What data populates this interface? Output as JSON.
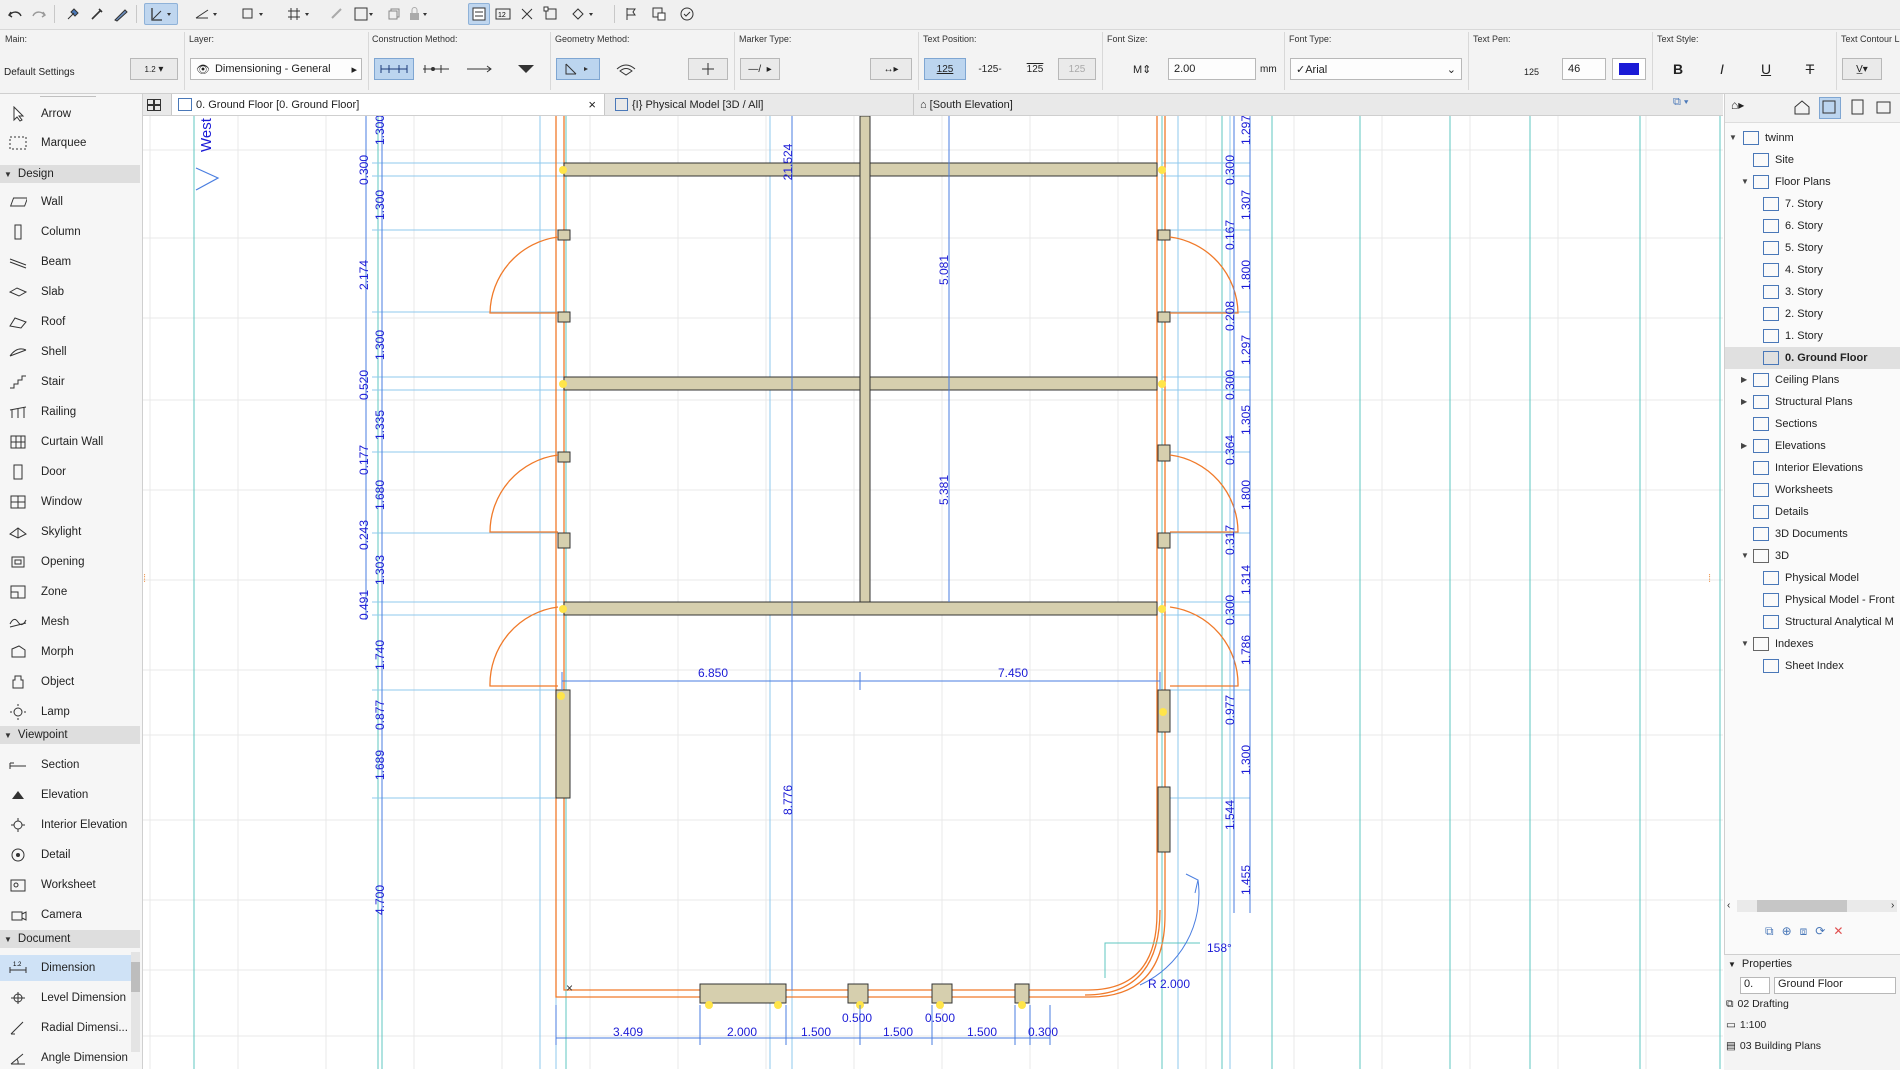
{
  "toolbar": {
    "icons": [
      "undo-icon",
      "redo-icon",
      "pick-up-icon",
      "eyedropper-icon",
      "inject-icon",
      "select-arrow-icon",
      "snap-guide-icon",
      "gravity-icon",
      "grid-icon",
      "lock-icon",
      "trace-icon",
      "layout-icon",
      "3d-view-icon",
      "flag-icon",
      "renovation-icon"
    ]
  },
  "infobox": {
    "main_label": "Main:",
    "main_value": "Default Settings",
    "main_scale": "1.2",
    "layer_label": "Layer:",
    "layer_value": "Dimensioning - General",
    "construction_label": "Construction Method:",
    "geometry_label": "Geometry Method:",
    "marker_label": "Marker Type:",
    "text_position_label": "Text Position:",
    "text_position_options": [
      "125",
      "-125-",
      "125",
      "125"
    ],
    "font_size_label": "Font Size:",
    "font_size_value": "2.00",
    "font_size_unit": "mm",
    "font_type_label": "Font Type:",
    "font_type_value": "✓Arial",
    "text_pen_label": "Text Pen:",
    "text_pen_prefix": "125",
    "text_pen_value": "46",
    "text_style_label": "Text Style:",
    "text_style_buttons": [
      "B",
      "I",
      "U",
      "T"
    ],
    "text_contour_label": "Text Contour Li"
  },
  "toolbox": {
    "arrow": "Arrow",
    "marquee": "Marquee",
    "design_group": "Design",
    "design_tools": [
      "Wall",
      "Column",
      "Beam",
      "Slab",
      "Roof",
      "Shell",
      "Stair",
      "Railing",
      "Curtain Wall",
      "Door",
      "Window",
      "Skylight",
      "Opening",
      "Zone",
      "Mesh",
      "Morph",
      "Object",
      "Lamp"
    ],
    "viewpoint_group": "Viewpoint",
    "viewpoint_tools": [
      "Section",
      "Elevation",
      "Interior Elevation",
      "Detail",
      "Worksheet",
      "Camera"
    ],
    "document_group": "Document",
    "document_tools": [
      "Dimension",
      "Level Dimension",
      "Radial Dimensi...",
      "Angle Dimension"
    ],
    "selected_tool": "Dimension"
  },
  "tabs": [
    {
      "label": "0. Ground Floor [0. Ground Floor]",
      "active": true,
      "close": "×"
    },
    {
      "label": "{I} Physical Model [3D / All]",
      "active": false
    },
    {
      "label": "[South Elevation]",
      "active": false
    }
  ],
  "canvas": {
    "elevation_marker": "West",
    "top_dim_text": "21.524",
    "left_dims": [
      "1.300",
      "0.300",
      "1.300",
      "2.174",
      "1.300",
      "0.520",
      "1.335",
      "0.177",
      "1.680",
      "0.243",
      "1.303",
      "0.491",
      "1.740",
      "0.877",
      "1.689",
      "4.700"
    ],
    "right_dims": [
      "1.297",
      "0.300",
      "1.307",
      "0.167",
      "1.800",
      "0.208",
      "1.297",
      "0.300",
      "1.305",
      "0.364",
      "1.800",
      "0.317",
      "1.314",
      "0.300",
      "1.786",
      "0.977",
      "1.300",
      "1.544",
      "1.455"
    ],
    "inner_vertical_dims": [
      "5.081",
      "5.381",
      "8.776"
    ],
    "horizontal_dims": [
      "6.850",
      "7.450"
    ],
    "bottom_dims": [
      "3.409",
      "2.000",
      "1.500",
      "0.500",
      "1.500",
      "0.500",
      "1.500",
      "0.300"
    ],
    "angle_text": "158°",
    "radius_text": "R 2.000"
  },
  "navigator": {
    "project": "twinm",
    "site": "Site",
    "floor_plans": "Floor Plans",
    "stories": [
      "7. Story",
      "6. Story",
      "5. Story",
      "4. Story",
      "3. Story",
      "2. Story",
      "1. Story",
      "0. Ground Floor"
    ],
    "ceiling_plans": "Ceiling Plans",
    "structural_plans": "Structural Plans",
    "sections": "Sections",
    "elevations": "Elevations",
    "interior_elevations": "Interior Elevations",
    "worksheets": "Worksheets",
    "details": "Details",
    "documents_3d": "3D Documents",
    "folder_3d": "3D",
    "models": [
      "Physical Model",
      "Physical Model - Front",
      "Structural Analytical M"
    ],
    "indexes": "Indexes",
    "sheet_index": "Sheet Index"
  },
  "properties": {
    "title": "Properties",
    "id_value": "0.",
    "name_value": "Ground Floor",
    "layer_combo": "02 Drafting",
    "scale": "1:100",
    "model_view": "03 Building Plans"
  },
  "colors": {
    "dimension_blue": "#1b1bd6",
    "wall_fill": "#d6cfae",
    "door_orange": "#f07a2a",
    "grid_line": "#e6e6e6",
    "selection_blue": "#cfe2f6"
  }
}
